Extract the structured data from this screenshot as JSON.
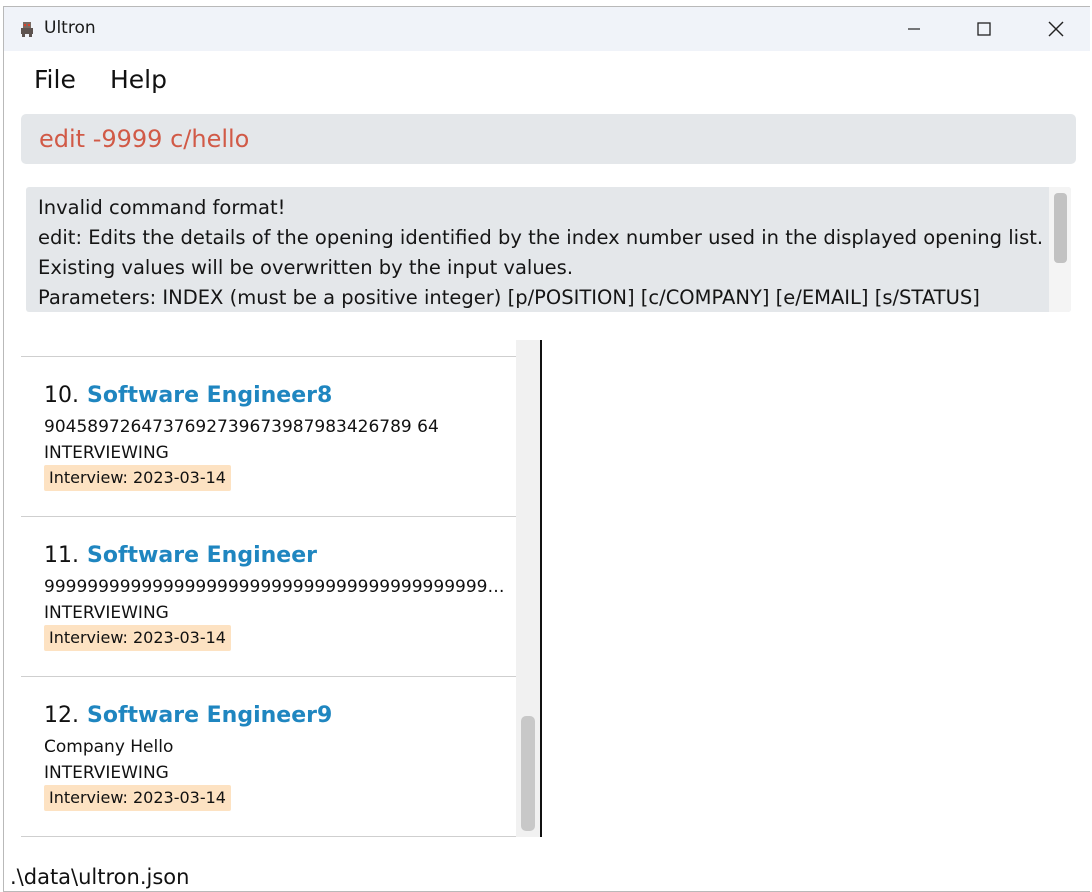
{
  "window": {
    "title": "Ultron",
    "controls": {
      "minimize": "minimize-icon",
      "maximize": "maximize-icon",
      "close": "close-icon"
    }
  },
  "menu": {
    "file": "File",
    "help": "Help"
  },
  "command": {
    "value": "edit -9999 c/hello"
  },
  "result": {
    "lines": [
      "Invalid command format!",
      "edit: Edits the details of the opening identified by the index number used in the displayed opening list.",
      "Existing values will be overwritten by the input values.",
      "Parameters: INDEX (must be a positive integer) [p/POSITION] [c/COMPANY] [e/EMAIL] [s/STATUS]"
    ]
  },
  "openings": [
    {
      "index": "10.",
      "position": "Software Engineer8",
      "company": "9045897264737692739673987983426789 64",
      "status": "INTERVIEWING",
      "tag": "Interview: 2023-03-14"
    },
    {
      "index": "11.",
      "position": "Software Engineer",
      "company": "99999999999999999999999999999999999999999999999999...",
      "status": "INTERVIEWING",
      "tag": "Interview: 2023-03-14"
    },
    {
      "index": "12.",
      "position": "Software Engineer9",
      "company": "Company Hello",
      "status": "INTERVIEWING",
      "tag": "Interview: 2023-03-14"
    }
  ],
  "statusbar": {
    "path": ".\\data\\ultron.json"
  },
  "colors": {
    "accent": "#1f86c0",
    "command_text": "#d15a47",
    "tag_bg": "#fde2c2"
  }
}
